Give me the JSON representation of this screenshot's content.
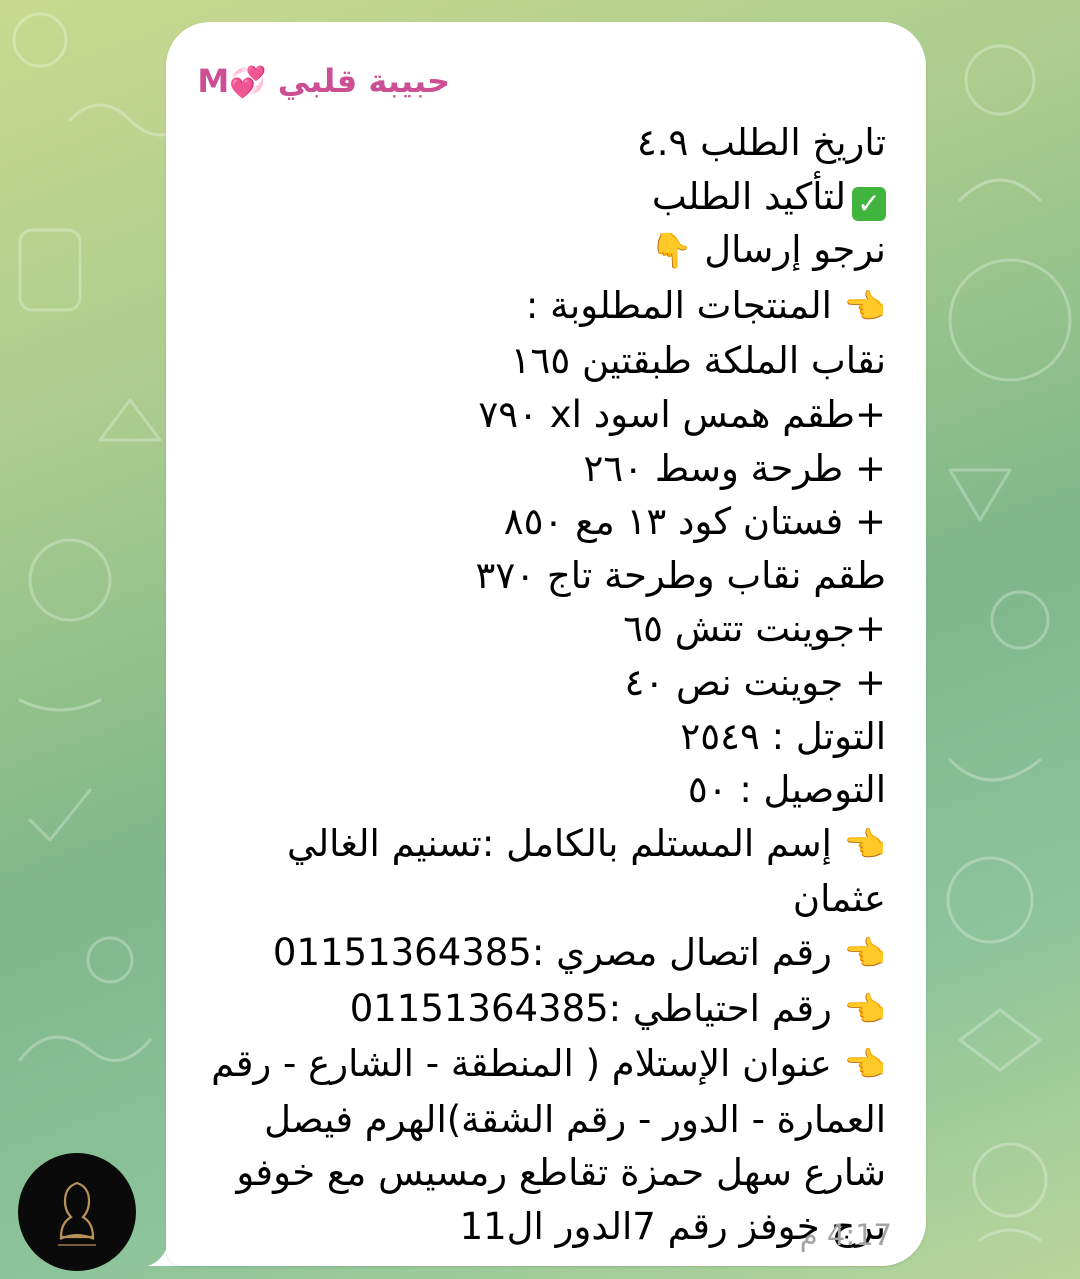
{
  "chat": {
    "sender_name": "حبيبة قلبي",
    "sender_suffix": "M",
    "sender_hearts": "💞",
    "time": "4:17 م"
  },
  "message": {
    "lines": [
      "تاريخ الطلب ٤.٩",
      "لتأكيد الطلب",
      "نرجو إرسال",
      "المنتجات المطلوبة :",
      "نقاب الملكة طبقتين ١٦٥",
      "+طقم همس اسود xl ٧٩٠",
      "+ طرحة وسط ٢٦٠",
      "+ فستان كود ١٣ مع ٨٥٠",
      "طقم نقاب وطرحة تاج ٣٧٠",
      "+جوينت تتش ٦٥",
      "+ جوينت نص ٤٠",
      "التوتل : ٢٥٤٩",
      "التوصيل : ٥٠",
      "إسم المستلم بالكامل :تسنيم الغالي عثمان",
      "رقم اتصال مصري :01151364385",
      "رقم احتياطي :01151364385",
      "عنوان الإستلام ( المنطقة - الشارع - رقم العمارة - الدور - رقم الشقة)الهرم فيصل شارع سهل حمزة تقاطع رمسيس مع خوفو برج خوفز رقم 7الدور ال11"
    ],
    "emoji_check": "✅",
    "emoji_point_down": "👇",
    "emoji_point_right": "👈"
  },
  "colors": {
    "sender": "#cc4f93",
    "time": "#a3a3a3",
    "bubble": "#ffffff",
    "background_start": "#c9d98f",
    "background_mid": "#7fb78a"
  },
  "icons": {
    "avatar": "brand-logo-icon"
  }
}
